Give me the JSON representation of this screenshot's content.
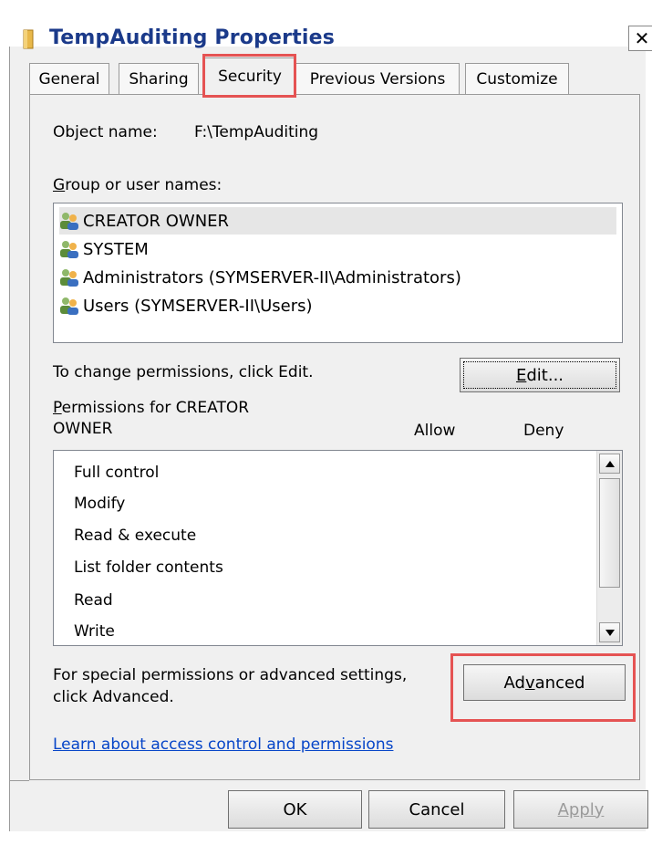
{
  "window": {
    "title": "TempAuditing Properties",
    "close_symbol": "✕"
  },
  "tabs": [
    {
      "label": "General",
      "active": false
    },
    {
      "label": "Sharing",
      "active": false
    },
    {
      "label": "Security",
      "active": true
    },
    {
      "label": "Previous Versions",
      "active": false
    },
    {
      "label": "Customize",
      "active": false
    }
  ],
  "security": {
    "object_name_label": "Object name:",
    "object_name_value": "F:\\TempAuditing",
    "group_label_accel": "G",
    "group_label_rest": "roup or user names:",
    "users": [
      {
        "name": "CREATOR OWNER",
        "selected": true
      },
      {
        "name": "SYSTEM",
        "selected": false
      },
      {
        "name": "Administrators (SYMSERVER-II\\Administrators)",
        "selected": false
      },
      {
        "name": "Users (SYMSERVER-II\\Users)",
        "selected": false
      }
    ],
    "change_text": "To change permissions, click Edit.",
    "edit_accel": "E",
    "edit_rest": "dit...",
    "perm_label_accel": "P",
    "perm_label_line1_rest": "ermissions for CREATOR",
    "perm_label_line2": "OWNER",
    "allow_header": "Allow",
    "deny_header": "Deny",
    "permissions": [
      "Full control",
      "Modify",
      "Read & execute",
      "List folder contents",
      "Read",
      "Write"
    ],
    "special_line1": "For special permissions or advanced settings,",
    "special_line2": "click Advanced.",
    "advanced_pre": "Ad",
    "advanced_accel": "v",
    "advanced_post": "anced",
    "learn_link": "Learn about access control and permissions"
  },
  "footer": {
    "ok": "OK",
    "cancel": "Cancel",
    "apply": "Apply"
  },
  "colors": {
    "highlight": "#e55353",
    "title_text": "#1b3a8a",
    "link": "#0645c8"
  }
}
